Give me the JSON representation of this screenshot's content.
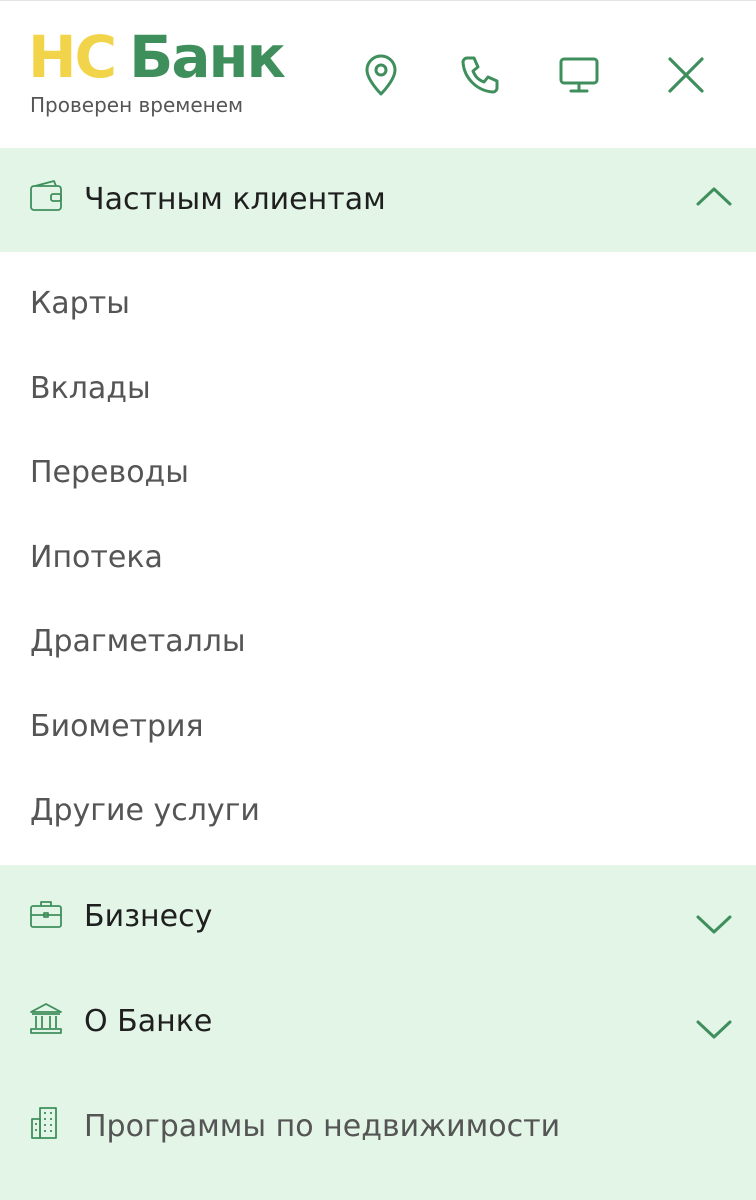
{
  "header": {
    "logo_part1": "НС",
    "logo_part2": "Банк",
    "tagline": "Проверен временем"
  },
  "colors": {
    "brand_green": "#3f8f5c",
    "brand_yellow": "#f2d44a",
    "section_bg": "#e3f5e6"
  },
  "menu": {
    "private": {
      "label": "Частным клиентам",
      "icon": "wallet-icon",
      "expanded": true,
      "items": [
        {
          "label": "Карты"
        },
        {
          "label": "Вклады"
        },
        {
          "label": "Переводы"
        },
        {
          "label": "Ипотека"
        },
        {
          "label": "Драгметаллы"
        },
        {
          "label": "Биометрия"
        },
        {
          "label": "Другие услуги"
        }
      ]
    },
    "business": {
      "label": "Бизнесу",
      "icon": "briefcase-icon",
      "expanded": false
    },
    "about": {
      "label": "О Банке",
      "icon": "bank-building-icon",
      "expanded": false
    },
    "realty": {
      "label": "Программы по недвижимости",
      "icon": "building-icon"
    }
  }
}
